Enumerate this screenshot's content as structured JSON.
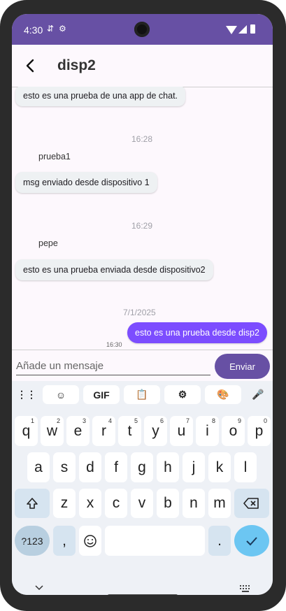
{
  "status": {
    "time": "4:30",
    "icons": [
      "data-saver-icon",
      "settings-icon",
      "wifi-icon",
      "signal-icon",
      "battery-icon"
    ]
  },
  "appbar": {
    "title": "disp2"
  },
  "messages": [
    {
      "type": "bubble",
      "text": "esto es una prueba de una app de chat."
    },
    {
      "type": "stamp",
      "text": "16:28"
    },
    {
      "type": "sender",
      "text": "prueba1"
    },
    {
      "type": "bubble",
      "text": "msg enviado desde dispositivo 1"
    },
    {
      "type": "stamp",
      "text": "16:29"
    },
    {
      "type": "sender",
      "text": "pepe"
    },
    {
      "type": "bubble",
      "text": "esto es una prueba enviada desde dispositivo2"
    },
    {
      "type": "stamp",
      "text": "7/1/2025"
    },
    {
      "type": "mine",
      "text": "esto es una prueba desde disp2"
    },
    {
      "type": "time",
      "text": "16:30"
    }
  ],
  "input": {
    "placeholder": "Añade un mensaje",
    "send_label": "Enviar"
  },
  "keyboard": {
    "toolbar": [
      "apps-icon",
      "sticker-icon",
      "GIF",
      "clipboard-icon",
      "settings-icon",
      "palette-icon",
      "mic-icon"
    ],
    "row1": [
      "q",
      "w",
      "e",
      "r",
      "t",
      "y",
      "u",
      "i",
      "o",
      "p"
    ],
    "row1_hints": [
      "1",
      "2",
      "3",
      "4",
      "5",
      "6",
      "7",
      "8",
      "9",
      "0"
    ],
    "row2": [
      "a",
      "s",
      "d",
      "f",
      "g",
      "h",
      "j",
      "k",
      "l"
    ],
    "row3": [
      "z",
      "x",
      "c",
      "v",
      "b",
      "n",
      "m"
    ],
    "symbols_label": "?123",
    "comma": ",",
    "period": "."
  },
  "colors": {
    "accent": "#6750a4",
    "mine_bubble": "#7c4dff",
    "enter": "#6cc6f2"
  }
}
